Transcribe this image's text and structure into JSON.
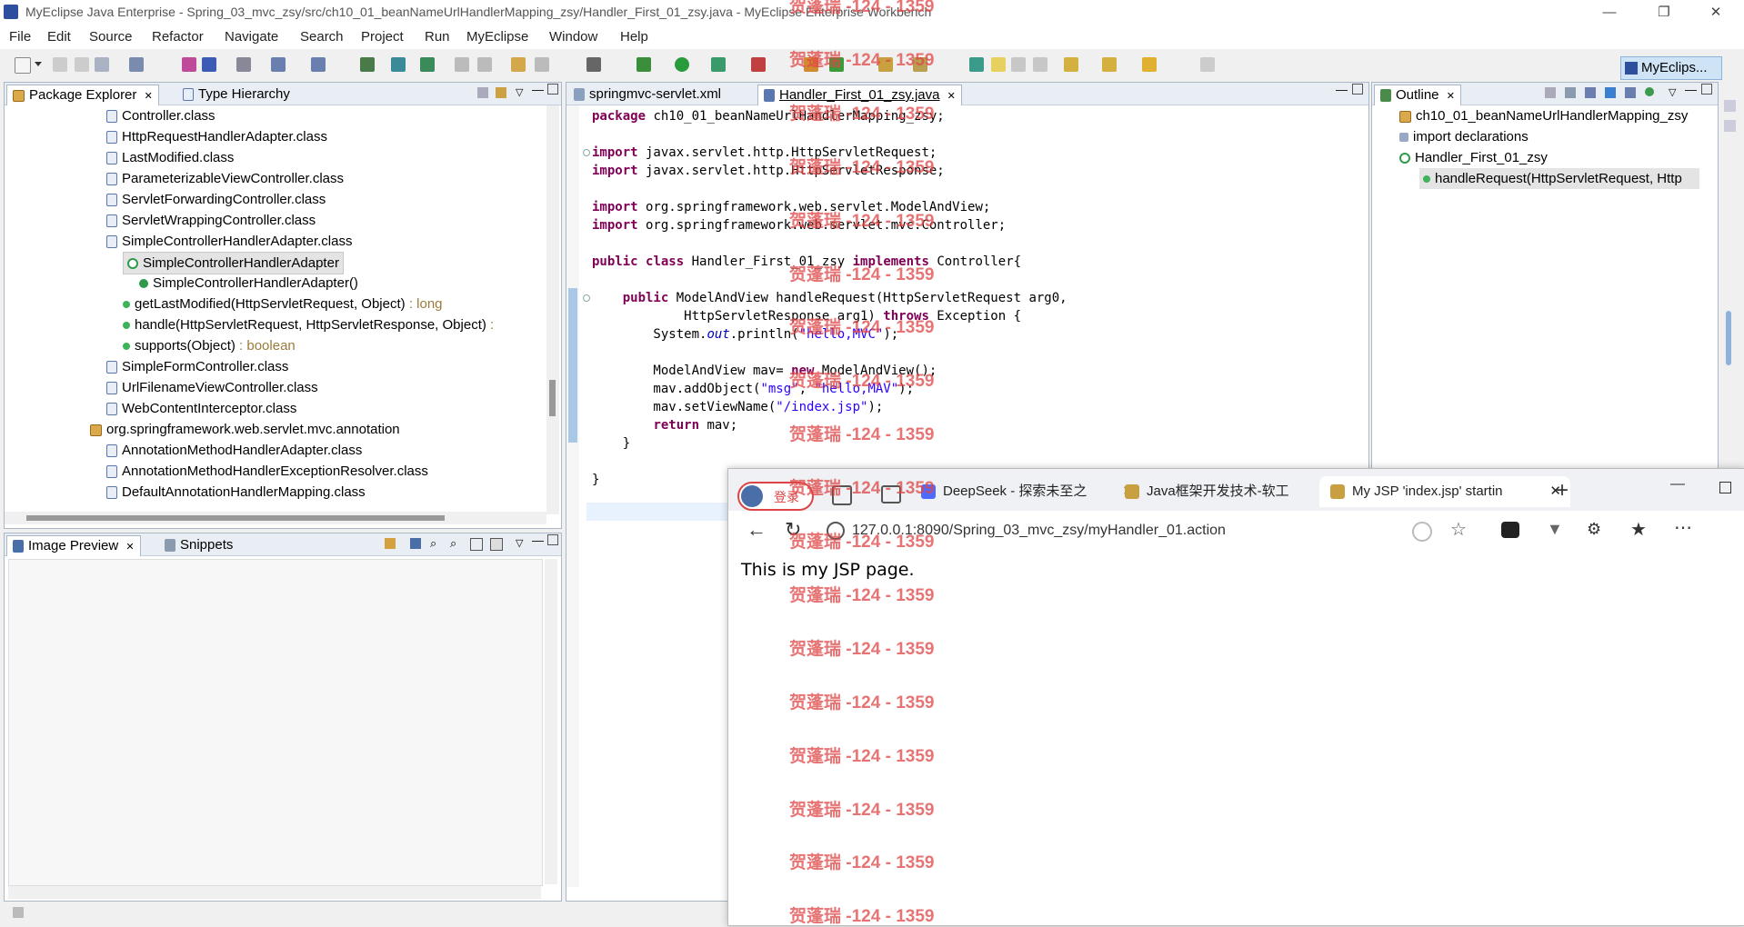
{
  "window": {
    "title": "MyEclipse Java Enterprise - Spring_03_mvc_zsy/src/ch10_01_beanNameUrlHandlerMapping_zsy/Handler_First_01_zsy.java - MyEclipse Enterprise Workbench"
  },
  "menu": [
    "File",
    "Edit",
    "Source",
    "Refactor",
    "Navigate",
    "Search",
    "Project",
    "Run",
    "MyEclipse",
    "Window",
    "Help"
  ],
  "perspective": "MyEclips...",
  "package_explorer": {
    "tabs": [
      "Package Explorer",
      "Type Hierarchy"
    ],
    "rows": [
      {
        "label": "Controller.class",
        "kind": "cls"
      },
      {
        "label": "HttpRequestHandlerAdapter.class",
        "kind": "cls"
      },
      {
        "label": "LastModified.class",
        "kind": "cls"
      },
      {
        "label": "ParameterizableViewController.class",
        "kind": "cls"
      },
      {
        "label": "ServletForwardingController.class",
        "kind": "cls"
      },
      {
        "label": "ServletWrappingController.class",
        "kind": "cls"
      },
      {
        "label": "SimpleControllerHandlerAdapter.class",
        "kind": "cls"
      },
      {
        "label": "SimpleControllerHandlerAdapter",
        "kind": "c"
      },
      {
        "label": "SimpleControllerHandlerAdapter()",
        "kind": "ctor"
      },
      {
        "label": "getLastModified(HttpServletRequest, Object)",
        "ret": " : long",
        "kind": "meth"
      },
      {
        "label": "handle(HttpServletRequest, HttpServletResponse, Object)",
        "ret": " :",
        "kind": "meth"
      },
      {
        "label": "supports(Object)",
        "ret": " : boolean",
        "kind": "meth"
      },
      {
        "label": "SimpleFormController.class",
        "kind": "cls"
      },
      {
        "label": "UrlFilenameViewController.class",
        "kind": "cls"
      },
      {
        "label": "WebContentInterceptor.class",
        "kind": "cls"
      },
      {
        "label": "org.springframework.web.servlet.mvc.annotation",
        "kind": "pkg"
      },
      {
        "label": "AnnotationMethodHandlerAdapter.class",
        "kind": "cls"
      },
      {
        "label": "AnnotationMethodHandlerExceptionResolver.class",
        "kind": "cls"
      },
      {
        "label": "DefaultAnnotationHandlerMapping.class",
        "kind": "cls"
      }
    ]
  },
  "image_preview": {
    "tabs": [
      "Image Preview",
      "Snippets"
    ]
  },
  "editor": {
    "tabs": [
      "springmvc-servlet.xml",
      "Handler_First_01_zsy.java"
    ],
    "lines": [
      [
        [
          "kw",
          "package"
        ],
        [
          "t",
          " ch10_01_beanNameUrlHandlerMapping_zsy;"
        ]
      ],
      [],
      [
        [
          "kw",
          "import"
        ],
        [
          "t",
          " javax.servlet.http.HttpServletRequest;"
        ]
      ],
      [
        [
          "kw",
          "import"
        ],
        [
          "t",
          " javax.servlet.http.HttpServletResponse;"
        ]
      ],
      [],
      [
        [
          "kw",
          "import"
        ],
        [
          "t",
          " org.springframework.web.servlet.ModelAndView;"
        ]
      ],
      [
        [
          "kw",
          "import"
        ],
        [
          "t",
          " org.springframework.web.servlet.mvc.Controller;"
        ]
      ],
      [],
      [
        [
          "kw",
          "public"
        ],
        [
          "t",
          " "
        ],
        [
          "kw",
          "class"
        ],
        [
          "t",
          " Handler_First_01_zsy "
        ],
        [
          "kw",
          "implements"
        ],
        [
          "t",
          " Controller{"
        ]
      ],
      [],
      [
        [
          "t",
          "    "
        ],
        [
          "kw",
          "public"
        ],
        [
          "t",
          " ModelAndView handleRequest(HttpServletRequest arg0,"
        ]
      ],
      [
        [
          "t",
          "            HttpServletResponse arg1) "
        ],
        [
          "kw",
          "throws"
        ],
        [
          "t",
          " Exception {"
        ]
      ],
      [
        [
          "t",
          "        System."
        ],
        [
          "fld",
          "out"
        ],
        [
          "t",
          ".println("
        ],
        [
          "str",
          "\"hello,MVC\""
        ],
        [
          "t",
          ");"
        ]
      ],
      [],
      [
        [
          "t",
          "        ModelAndView mav= "
        ],
        [
          "kw",
          "new"
        ],
        [
          "t",
          " ModelAndView();"
        ]
      ],
      [
        [
          "t",
          "        mav.addObject("
        ],
        [
          "str",
          "\"msg\""
        ],
        [
          "t",
          ", "
        ],
        [
          "str",
          "\"hello,MAV\""
        ],
        [
          "t",
          ");"
        ]
      ],
      [
        [
          "t",
          "        mav.setViewName("
        ],
        [
          "str",
          "\"/index.jsp\""
        ],
        [
          "t",
          ");"
        ]
      ],
      [
        [
          "t",
          "        "
        ],
        [
          "kw",
          "return"
        ],
        [
          "t",
          " mav;"
        ]
      ],
      [
        [
          "t",
          "    }"
        ]
      ],
      [],
      [
        [
          "t",
          "}"
        ]
      ]
    ]
  },
  "outline": {
    "tab": "Outline",
    "rows": [
      {
        "label": "ch10_01_beanNameUrlHandlerMapping_zsy",
        "kind": "pkg"
      },
      {
        "label": "import declarations",
        "kind": "imp"
      },
      {
        "label": "Handler_First_01_zsy",
        "kind": "c"
      },
      {
        "label": "handleRequest(HttpServletRequest, Http",
        "kind": "meth"
      }
    ]
  },
  "browser": {
    "login": "登录",
    "tabs": [
      "DeepSeek - 探索未至之",
      "Java框架开发技术-软工",
      "My JSP 'index.jsp' startin"
    ],
    "url": "127.0.0.1:8090/Spring_03_mvc_zsy/myHandler_01.action",
    "content": "This is my JSP page."
  },
  "watermark": "贺蓬瑞 -124 - 1359"
}
